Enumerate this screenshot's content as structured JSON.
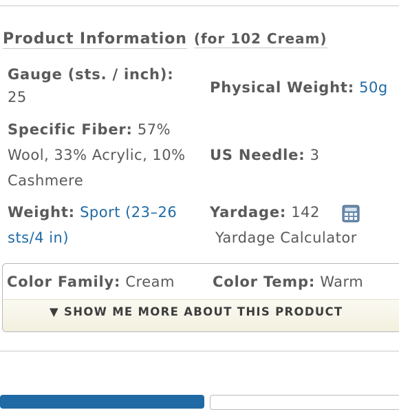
{
  "section": {
    "title": "Product Information",
    "subtitle": "(for 102 Cream)"
  },
  "specs": {
    "gauge_label": "Gauge (sts. / inch):",
    "gauge_value": "25",
    "physical_weight_label": "Physical Weight:",
    "physical_weight_value": "50g",
    "fiber_label": "Specific Fiber:",
    "fiber_value": "57% Wool, 33% Acrylic, 10% Cashmere",
    "needle_label": "US Needle:",
    "needle_value": "3",
    "weight_label": "Weight:",
    "weight_value": "Sport (23–26 sts/4 in)",
    "yardage_label": "Yardage:",
    "yardage_value": "142",
    "yardage_calculator": "Yardage Calculator"
  },
  "more": {
    "color_family_label": "Color Family:",
    "color_family_value": "Cream",
    "color_temp_label": "Color Temp:",
    "color_temp_value": "Warm",
    "show_more": "▼ SHOW ME MORE ABOUT THIS PRODUCT"
  },
  "colors": {
    "link": "#1f6aa5",
    "primary_button": "#1f6aa5"
  },
  "icons": {
    "calculator": "calculator-icon"
  }
}
